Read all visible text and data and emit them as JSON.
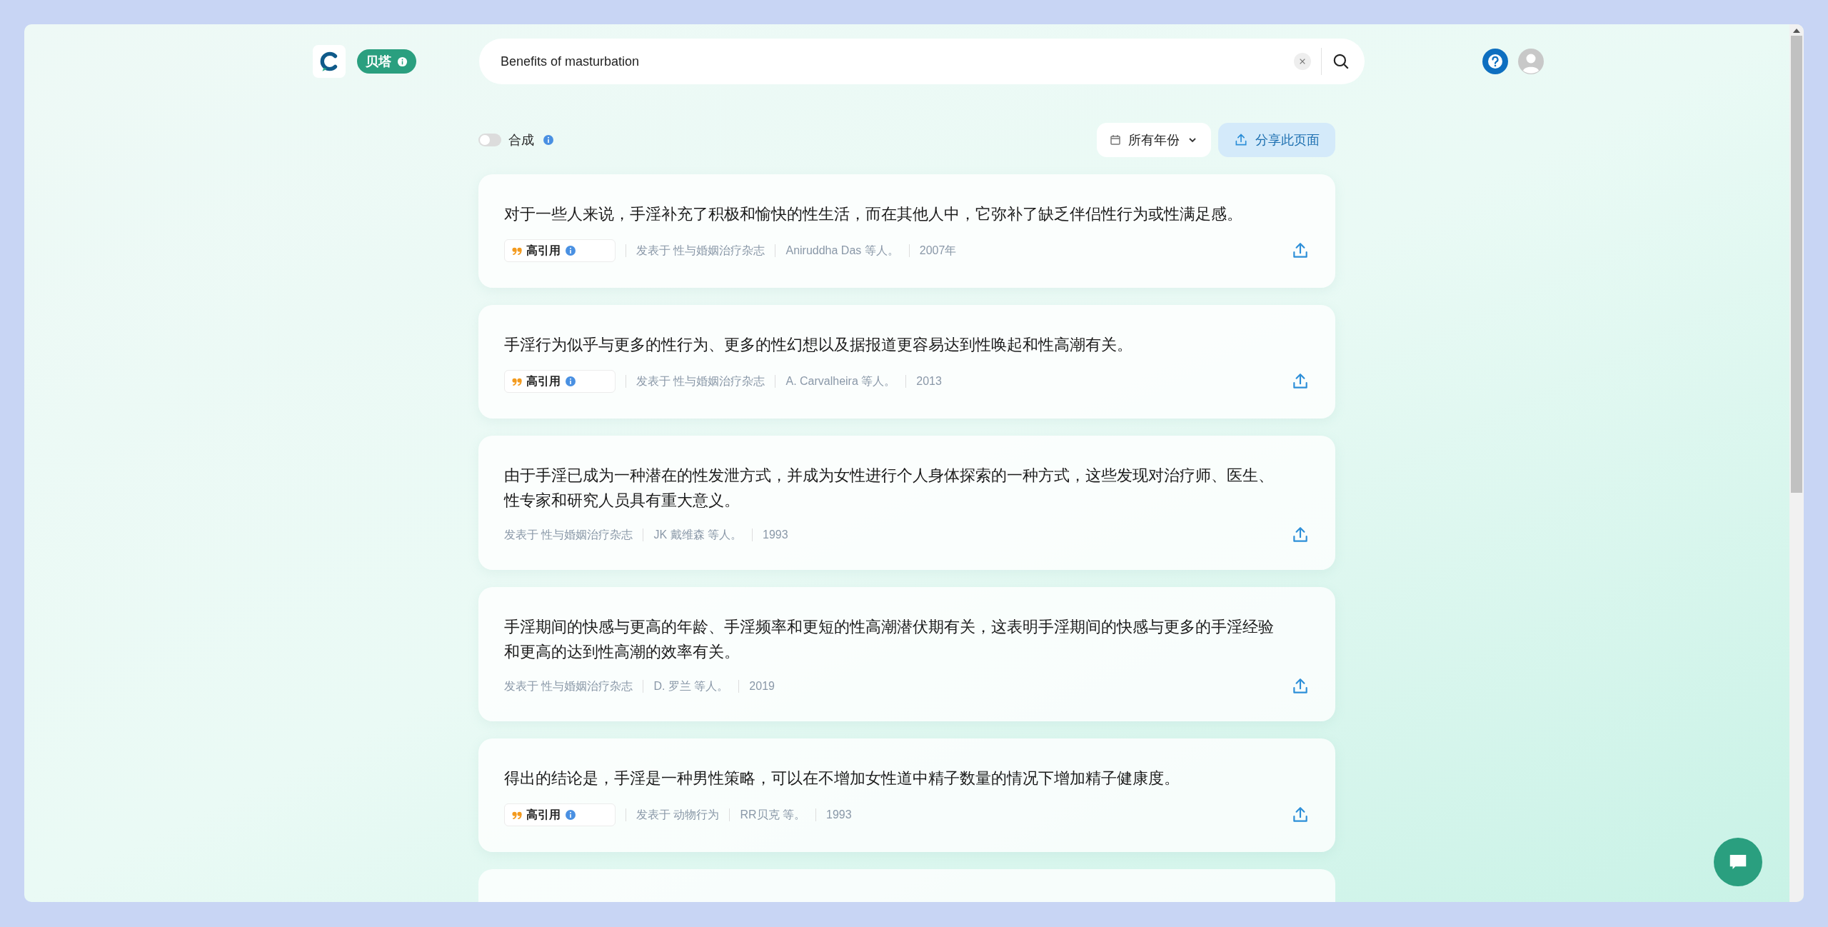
{
  "header": {
    "badge": "贝塔",
    "search": {
      "value": "Benefits of masturbation"
    }
  },
  "controls": {
    "synthesis": {
      "label": "合成",
      "on": false
    },
    "year_filter": "所有年份",
    "share_page": "分享此页面"
  },
  "results": [
    {
      "claim": "对于一些人来说，手淫补充了积极和愉快的性生活，而在其他人中，它弥补了缺乏伴侣性行为或性满足感。",
      "highly_cited": true,
      "badge": "高引用",
      "journal": "发表于 性与婚姻治疗杂志",
      "authors": "Aniruddha Das 等人。",
      "year": "2007年"
    },
    {
      "claim": "手淫行为似乎与更多的性行为、更多的性幻想以及据报道更容易达到性唤起和性高潮有关。",
      "highly_cited": true,
      "badge": "高引用",
      "journal": "发表于 性与婚姻治疗杂志",
      "authors": "A. Carvalheira 等人。",
      "year": "2013"
    },
    {
      "claim": "由于手淫已成为一种潜在的性发泄方式，并成为女性进行个人身体探索的一种方式，这些发现对治疗师、医生、性专家和研究人员具有重大意义。",
      "highly_cited": false,
      "journal": "发表于 性与婚姻治疗杂志",
      "authors": "JK 戴维森 等人。",
      "year": "1993"
    },
    {
      "claim": "手淫期间的快感与更高的年龄、手淫频率和更短的性高潮潜伏期有关，这表明手淫期间的快感与更多的手淫经验和更高的达到性高潮的效率有关。",
      "highly_cited": false,
      "journal": "发表于 性与婚姻治疗杂志",
      "authors": "D. 罗兰 等人。",
      "year": "2019"
    },
    {
      "claim": "得出的结论是，手淫是一种男性策略，可以在不增加女性道中精子数量的情况下增加精子健康度。",
      "highly_cited": true,
      "badge": "高引用",
      "journal": "发表于 动物行为",
      "authors": "RR贝克 等。",
      "year": "1993"
    }
  ]
}
